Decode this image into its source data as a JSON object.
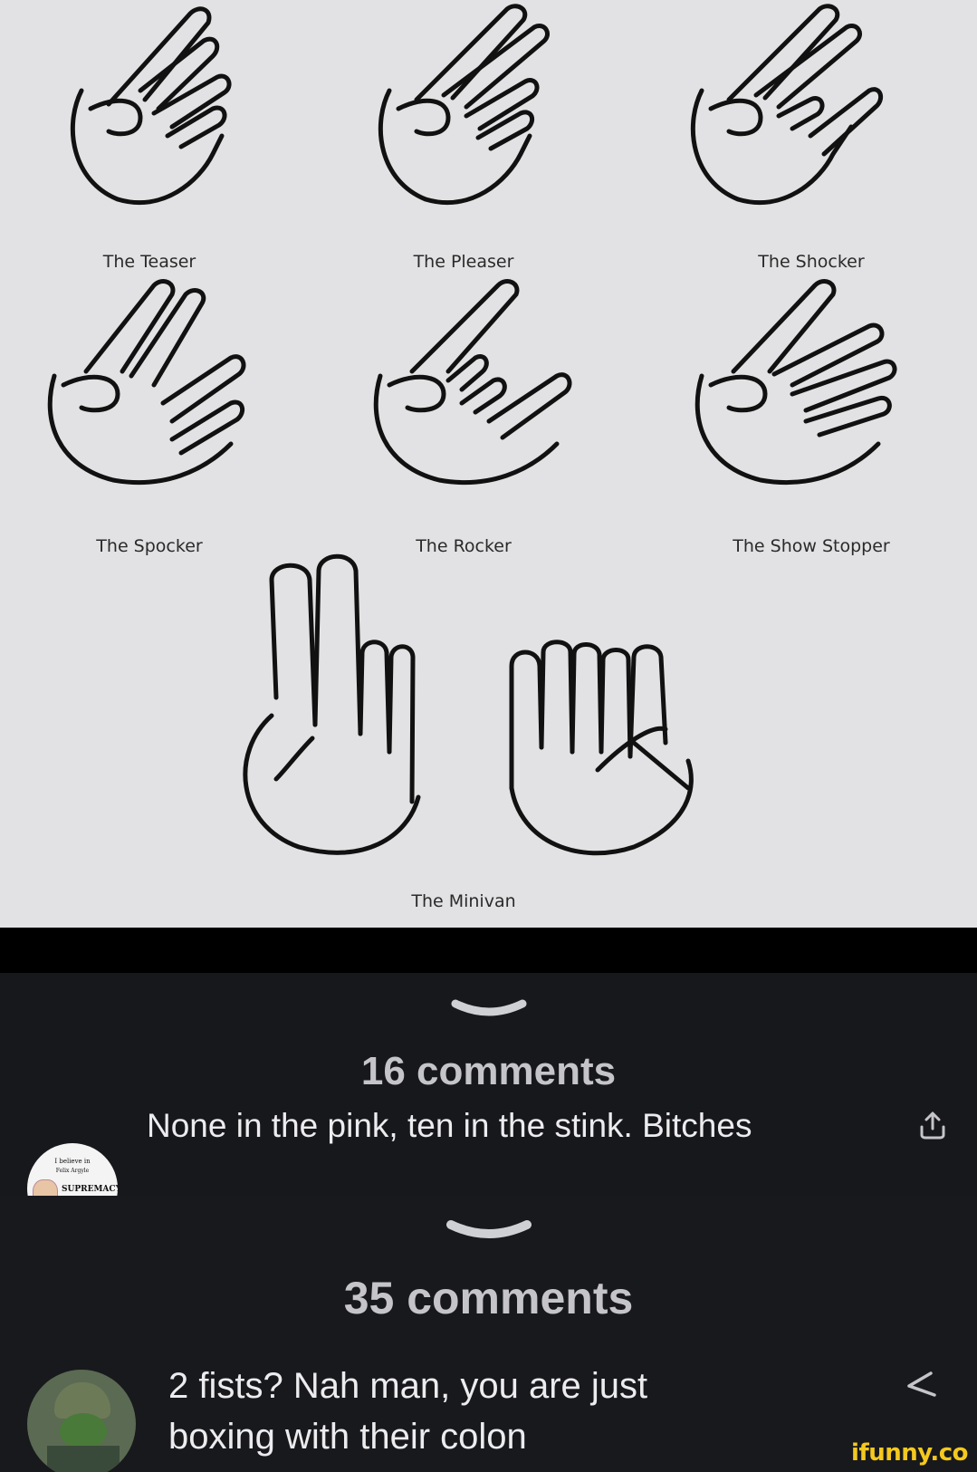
{
  "meme": {
    "labels": {
      "teaser": "The Teaser",
      "pleaser": "The Pleaser",
      "shocker": "The Shocker",
      "spocker": "The Spocker",
      "rocker": "The Rocker",
      "show_stopper": "The Show Stopper",
      "minivan": "The Minivan"
    }
  },
  "screens": [
    {
      "comment_count": "16 comments",
      "avatar_badge": {
        "line1": "I believe in",
        "line2": "Felix Argyle",
        "line3": "SUPREMACY"
      },
      "comment_text": "None in the pink, ten in the stink. Bitches",
      "action_icon": "share-icon"
    },
    {
      "comment_count": "35 comments",
      "comment_line1": "2 fists? Nah man, you are just",
      "comment_line2": "boxing with their colon",
      "action_icon": "share-icon"
    }
  ],
  "watermark": "ifunny.co",
  "colors": {
    "panel_bg": "#17181c",
    "count_text": "#c5c5c9",
    "comment_text": "#ececee",
    "watermark": "#f4c81e"
  }
}
